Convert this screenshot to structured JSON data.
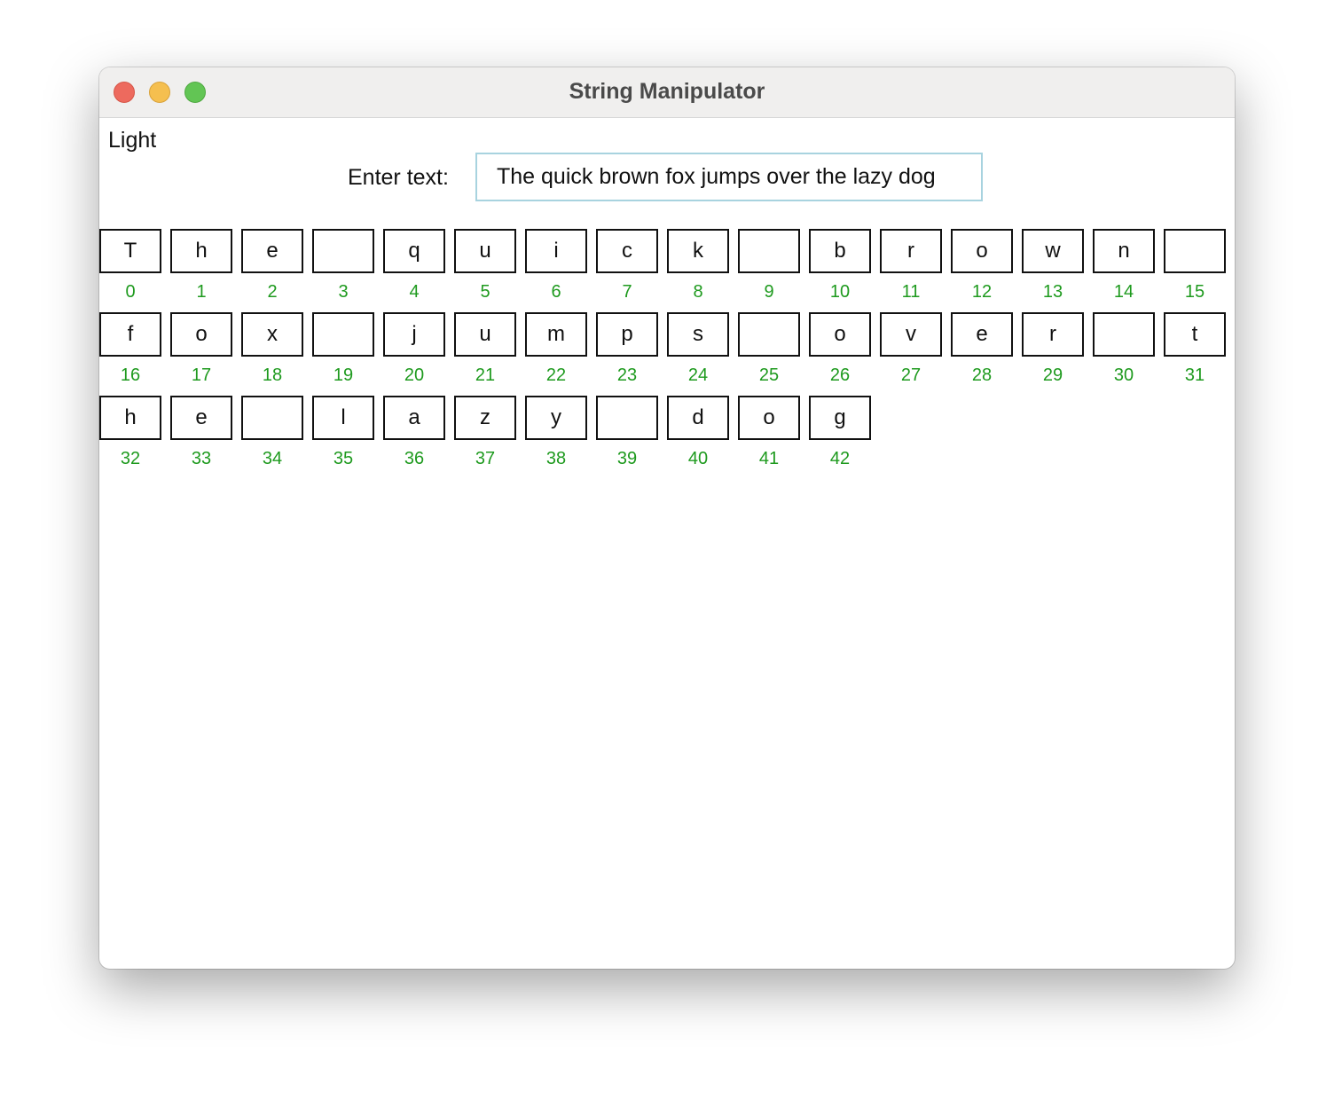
{
  "window": {
    "title": "String Manipulator",
    "controls": [
      "close",
      "minimize",
      "maximize"
    ]
  },
  "theme_label": "Light",
  "input": {
    "label": "Enter text:",
    "value": "The quick brown fox jumps over the lazy dog"
  },
  "colors": {
    "index_color": "#1e9a1e",
    "input_border": "#a8d3df"
  },
  "characters": [
    {
      "char": "T",
      "index": "0"
    },
    {
      "char": "h",
      "index": "1"
    },
    {
      "char": "e",
      "index": "2"
    },
    {
      "char": " ",
      "index": "3"
    },
    {
      "char": "q",
      "index": "4"
    },
    {
      "char": "u",
      "index": "5"
    },
    {
      "char": "i",
      "index": "6"
    },
    {
      "char": "c",
      "index": "7"
    },
    {
      "char": "k",
      "index": "8"
    },
    {
      "char": " ",
      "index": "9"
    },
    {
      "char": "b",
      "index": "10"
    },
    {
      "char": "r",
      "index": "11"
    },
    {
      "char": "o",
      "index": "12"
    },
    {
      "char": "w",
      "index": "13"
    },
    {
      "char": "n",
      "index": "14"
    },
    {
      "char": " ",
      "index": "15"
    },
    {
      "char": "f",
      "index": "16"
    },
    {
      "char": "o",
      "index": "17"
    },
    {
      "char": "x",
      "index": "18"
    },
    {
      "char": " ",
      "index": "19"
    },
    {
      "char": "j",
      "index": "20"
    },
    {
      "char": "u",
      "index": "21"
    },
    {
      "char": "m",
      "index": "22"
    },
    {
      "char": "p",
      "index": "23"
    },
    {
      "char": "s",
      "index": "24"
    },
    {
      "char": " ",
      "index": "25"
    },
    {
      "char": "o",
      "index": "26"
    },
    {
      "char": "v",
      "index": "27"
    },
    {
      "char": "e",
      "index": "28"
    },
    {
      "char": "r",
      "index": "29"
    },
    {
      "char": " ",
      "index": "30"
    },
    {
      "char": "t",
      "index": "31"
    },
    {
      "char": "h",
      "index": "32"
    },
    {
      "char": "e",
      "index": "33"
    },
    {
      "char": " ",
      "index": "34"
    },
    {
      "char": "l",
      "index": "35"
    },
    {
      "char": "a",
      "index": "36"
    },
    {
      "char": "z",
      "index": "37"
    },
    {
      "char": "y",
      "index": "38"
    },
    {
      "char": " ",
      "index": "39"
    },
    {
      "char": "d",
      "index": "40"
    },
    {
      "char": "o",
      "index": "41"
    },
    {
      "char": "g",
      "index": "42"
    }
  ]
}
